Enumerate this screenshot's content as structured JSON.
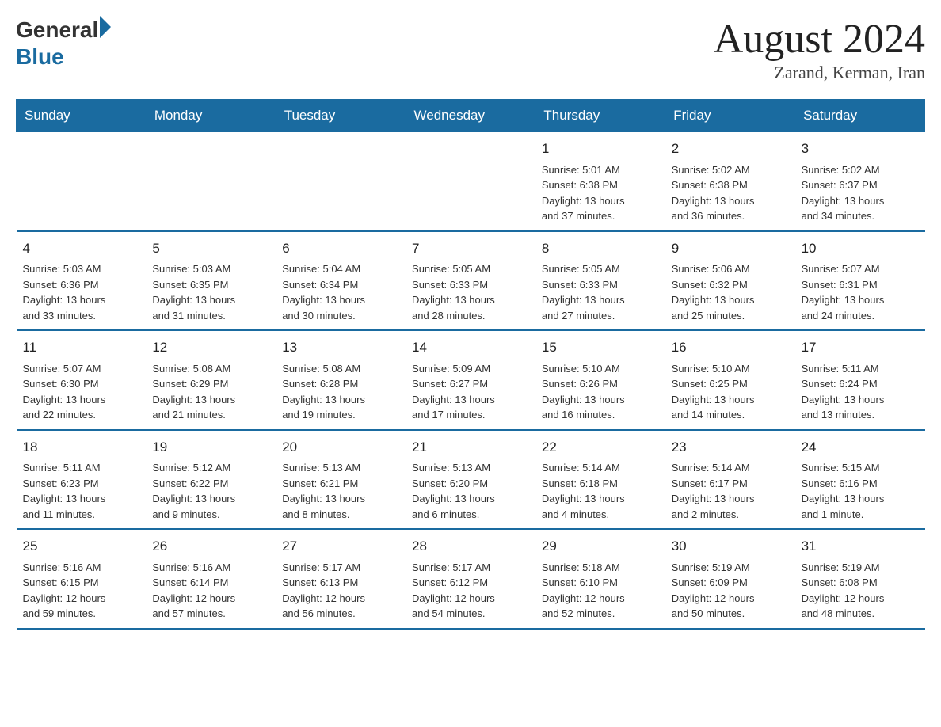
{
  "header": {
    "title": "August 2024",
    "location": "Zarand, Kerman, Iran",
    "logo_general": "General",
    "logo_blue": "Blue"
  },
  "weekdays": [
    "Sunday",
    "Monday",
    "Tuesday",
    "Wednesday",
    "Thursday",
    "Friday",
    "Saturday"
  ],
  "weeks": [
    [
      {
        "day": "",
        "info": ""
      },
      {
        "day": "",
        "info": ""
      },
      {
        "day": "",
        "info": ""
      },
      {
        "day": "",
        "info": ""
      },
      {
        "day": "1",
        "info": "Sunrise: 5:01 AM\nSunset: 6:38 PM\nDaylight: 13 hours\nand 37 minutes."
      },
      {
        "day": "2",
        "info": "Sunrise: 5:02 AM\nSunset: 6:38 PM\nDaylight: 13 hours\nand 36 minutes."
      },
      {
        "day": "3",
        "info": "Sunrise: 5:02 AM\nSunset: 6:37 PM\nDaylight: 13 hours\nand 34 minutes."
      }
    ],
    [
      {
        "day": "4",
        "info": "Sunrise: 5:03 AM\nSunset: 6:36 PM\nDaylight: 13 hours\nand 33 minutes."
      },
      {
        "day": "5",
        "info": "Sunrise: 5:03 AM\nSunset: 6:35 PM\nDaylight: 13 hours\nand 31 minutes."
      },
      {
        "day": "6",
        "info": "Sunrise: 5:04 AM\nSunset: 6:34 PM\nDaylight: 13 hours\nand 30 minutes."
      },
      {
        "day": "7",
        "info": "Sunrise: 5:05 AM\nSunset: 6:33 PM\nDaylight: 13 hours\nand 28 minutes."
      },
      {
        "day": "8",
        "info": "Sunrise: 5:05 AM\nSunset: 6:33 PM\nDaylight: 13 hours\nand 27 minutes."
      },
      {
        "day": "9",
        "info": "Sunrise: 5:06 AM\nSunset: 6:32 PM\nDaylight: 13 hours\nand 25 minutes."
      },
      {
        "day": "10",
        "info": "Sunrise: 5:07 AM\nSunset: 6:31 PM\nDaylight: 13 hours\nand 24 minutes."
      }
    ],
    [
      {
        "day": "11",
        "info": "Sunrise: 5:07 AM\nSunset: 6:30 PM\nDaylight: 13 hours\nand 22 minutes."
      },
      {
        "day": "12",
        "info": "Sunrise: 5:08 AM\nSunset: 6:29 PM\nDaylight: 13 hours\nand 21 minutes."
      },
      {
        "day": "13",
        "info": "Sunrise: 5:08 AM\nSunset: 6:28 PM\nDaylight: 13 hours\nand 19 minutes."
      },
      {
        "day": "14",
        "info": "Sunrise: 5:09 AM\nSunset: 6:27 PM\nDaylight: 13 hours\nand 17 minutes."
      },
      {
        "day": "15",
        "info": "Sunrise: 5:10 AM\nSunset: 6:26 PM\nDaylight: 13 hours\nand 16 minutes."
      },
      {
        "day": "16",
        "info": "Sunrise: 5:10 AM\nSunset: 6:25 PM\nDaylight: 13 hours\nand 14 minutes."
      },
      {
        "day": "17",
        "info": "Sunrise: 5:11 AM\nSunset: 6:24 PM\nDaylight: 13 hours\nand 13 minutes."
      }
    ],
    [
      {
        "day": "18",
        "info": "Sunrise: 5:11 AM\nSunset: 6:23 PM\nDaylight: 13 hours\nand 11 minutes."
      },
      {
        "day": "19",
        "info": "Sunrise: 5:12 AM\nSunset: 6:22 PM\nDaylight: 13 hours\nand 9 minutes."
      },
      {
        "day": "20",
        "info": "Sunrise: 5:13 AM\nSunset: 6:21 PM\nDaylight: 13 hours\nand 8 minutes."
      },
      {
        "day": "21",
        "info": "Sunrise: 5:13 AM\nSunset: 6:20 PM\nDaylight: 13 hours\nand 6 minutes."
      },
      {
        "day": "22",
        "info": "Sunrise: 5:14 AM\nSunset: 6:18 PM\nDaylight: 13 hours\nand 4 minutes."
      },
      {
        "day": "23",
        "info": "Sunrise: 5:14 AM\nSunset: 6:17 PM\nDaylight: 13 hours\nand 2 minutes."
      },
      {
        "day": "24",
        "info": "Sunrise: 5:15 AM\nSunset: 6:16 PM\nDaylight: 13 hours\nand 1 minute."
      }
    ],
    [
      {
        "day": "25",
        "info": "Sunrise: 5:16 AM\nSunset: 6:15 PM\nDaylight: 12 hours\nand 59 minutes."
      },
      {
        "day": "26",
        "info": "Sunrise: 5:16 AM\nSunset: 6:14 PM\nDaylight: 12 hours\nand 57 minutes."
      },
      {
        "day": "27",
        "info": "Sunrise: 5:17 AM\nSunset: 6:13 PM\nDaylight: 12 hours\nand 56 minutes."
      },
      {
        "day": "28",
        "info": "Sunrise: 5:17 AM\nSunset: 6:12 PM\nDaylight: 12 hours\nand 54 minutes."
      },
      {
        "day": "29",
        "info": "Sunrise: 5:18 AM\nSunset: 6:10 PM\nDaylight: 12 hours\nand 52 minutes."
      },
      {
        "day": "30",
        "info": "Sunrise: 5:19 AM\nSunset: 6:09 PM\nDaylight: 12 hours\nand 50 minutes."
      },
      {
        "day": "31",
        "info": "Sunrise: 5:19 AM\nSunset: 6:08 PM\nDaylight: 12 hours\nand 48 minutes."
      }
    ]
  ]
}
